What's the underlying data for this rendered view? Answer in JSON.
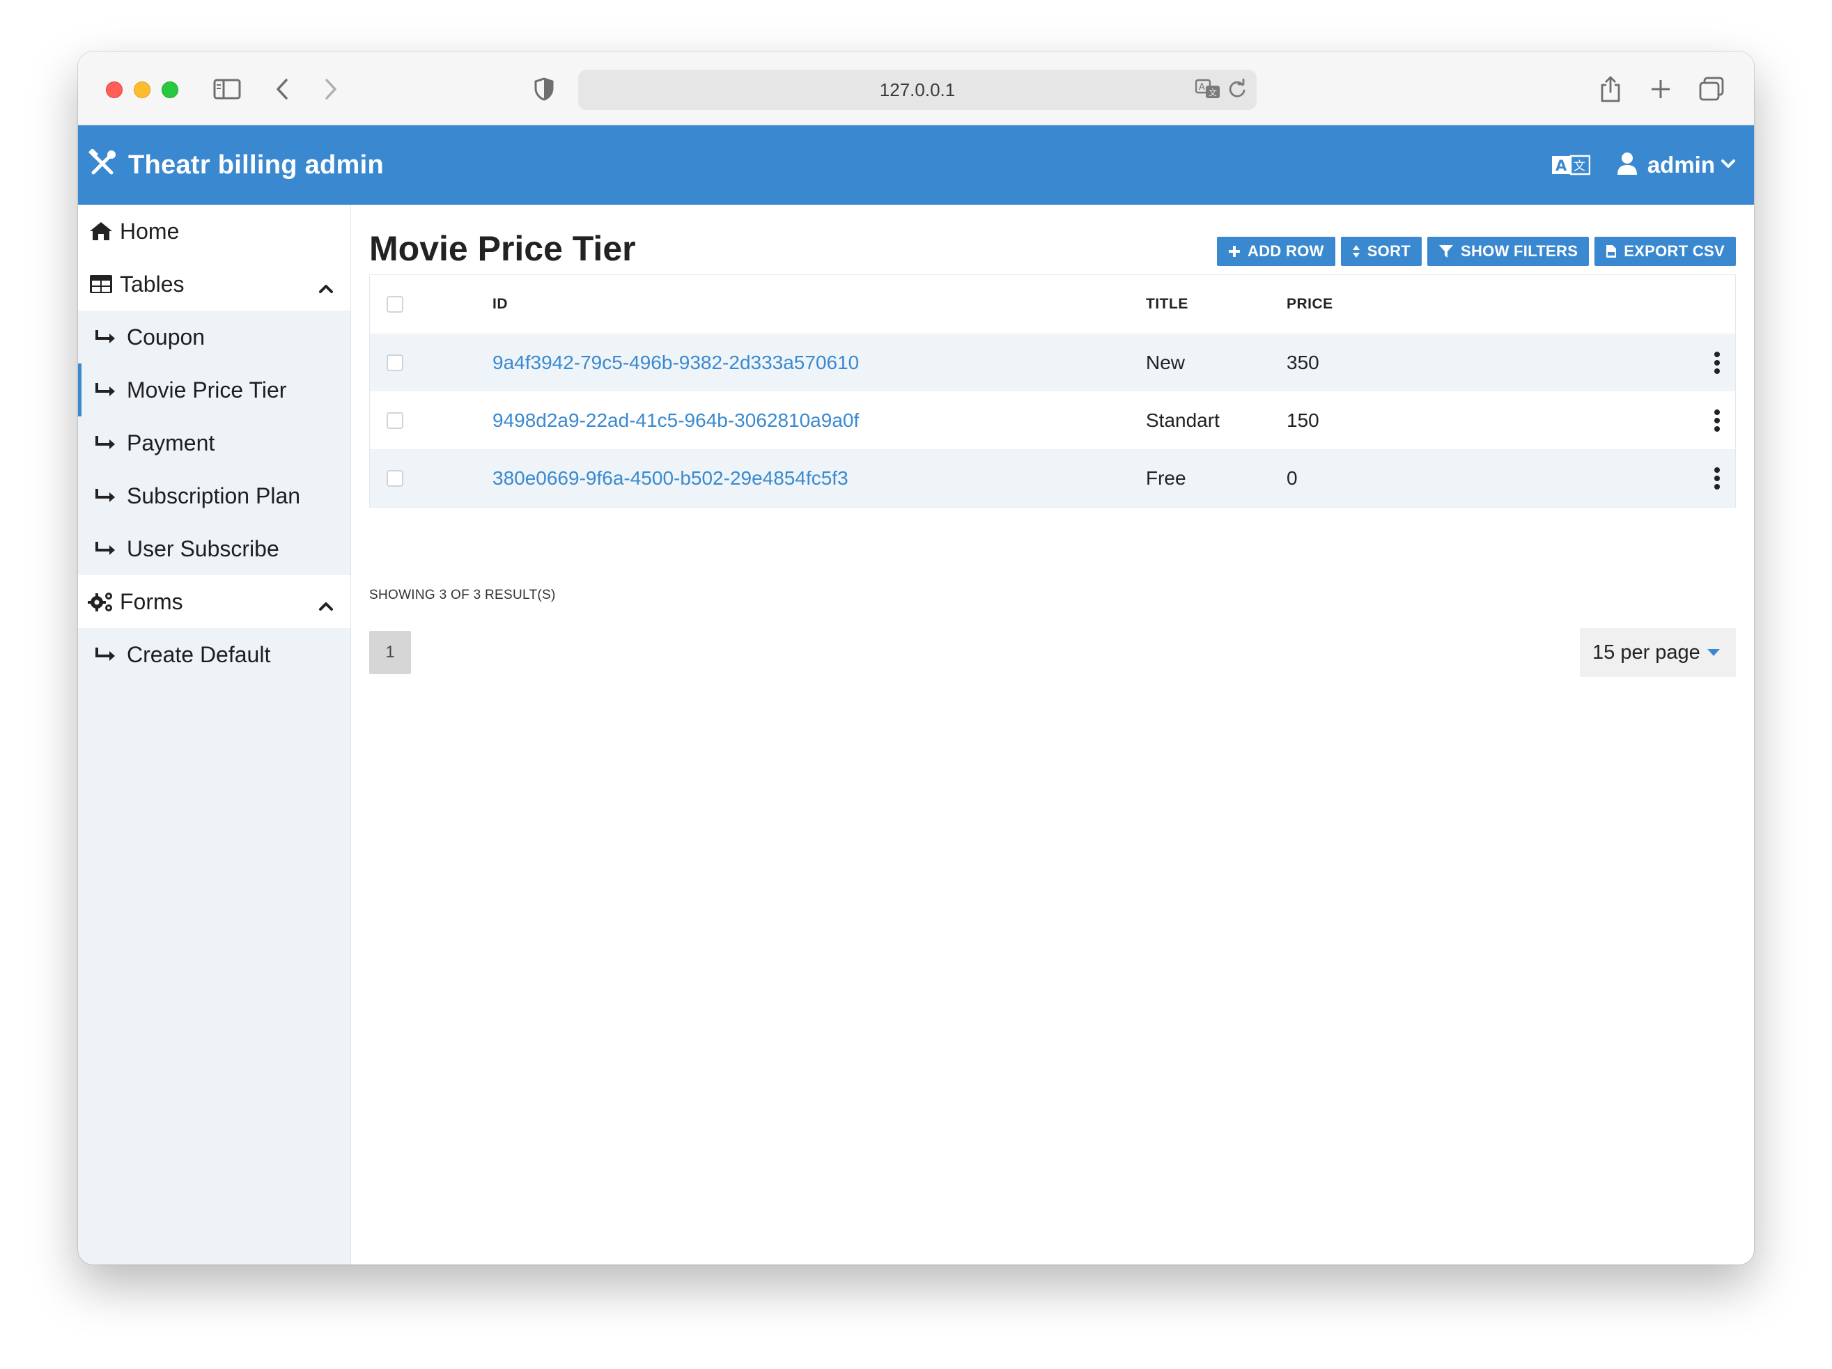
{
  "browser": {
    "url": "127.0.0.1"
  },
  "app": {
    "title": "Theatr billing admin",
    "user_name": "admin"
  },
  "sidebar": {
    "home": "Home",
    "tables": {
      "label": "Tables",
      "items": [
        "Coupon",
        "Movie Price Tier",
        "Payment",
        "Subscription Plan",
        "User Subscribe"
      ]
    },
    "forms": {
      "label": "Forms",
      "items": [
        "Create Default"
      ]
    },
    "active_item": "Movie Price Tier"
  },
  "page": {
    "title": "Movie Price Tier",
    "actions": {
      "add_row": "ADD ROW",
      "sort": "SORT",
      "show_filters": "SHOW FILTERS",
      "export_csv": "EXPORT CSV"
    }
  },
  "table": {
    "columns": [
      "ID",
      "TITLE",
      "PRICE"
    ],
    "rows": [
      {
        "id": "9a4f3942-79c5-496b-9382-2d333a570610",
        "title": "New",
        "price": "350"
      },
      {
        "id": "9498d2a9-22ad-41c5-964b-3062810a9a0f",
        "title": "Standart",
        "price": "150"
      },
      {
        "id": "380e0669-9f6a-4500-b502-29e4854fc5f3",
        "title": "Free",
        "price": "0"
      }
    ]
  },
  "footer": {
    "result_text": "SHOWING 3 OF 3 RESULT(S)",
    "current_page": "1",
    "per_page": "15 per page"
  },
  "colors": {
    "primary": "#3a89d0",
    "sidebar_bg": "#eef3f8",
    "row_alt": "#eff4f9"
  }
}
